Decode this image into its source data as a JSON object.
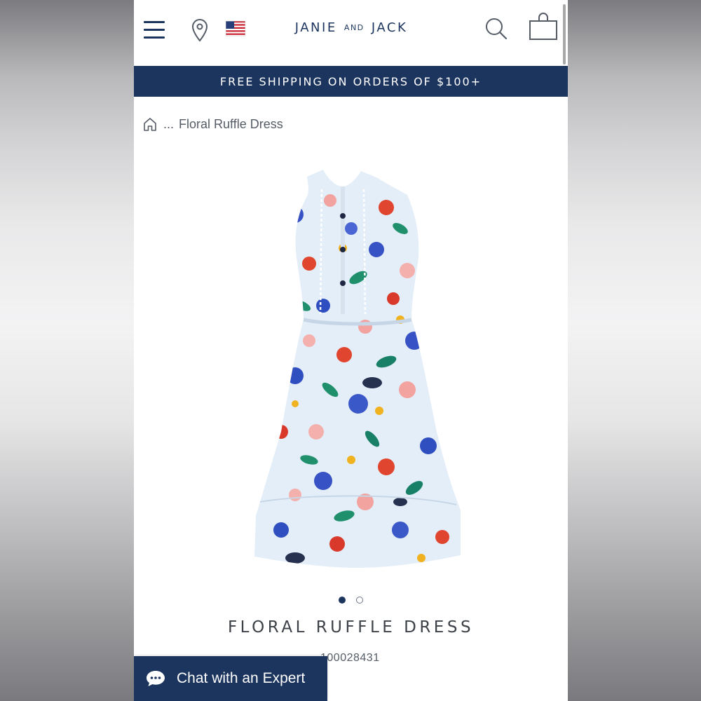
{
  "header": {
    "brand_left": "JANIE",
    "brand_mid": "AND",
    "brand_right": "JACK",
    "icons": [
      "menu-icon",
      "location-pin-icon",
      "us-flag-icon",
      "search-icon",
      "shopping-bag-icon"
    ]
  },
  "banner": {
    "text": "FREE SHIPPING ON ORDERS OF $100+"
  },
  "breadcrumb": {
    "ellipsis": "...",
    "current": "Floral Ruffle Dress"
  },
  "carousel": {
    "total_images": 2,
    "active_index": 1
  },
  "product": {
    "title": "FLORAL RUFFLE DRESS",
    "item_number": "100028431"
  },
  "chat": {
    "label": "Chat with an Expert"
  },
  "colors": {
    "brand_navy": "#1c355e",
    "text_gray": "#555c66",
    "title_gray": "#3d4148"
  }
}
